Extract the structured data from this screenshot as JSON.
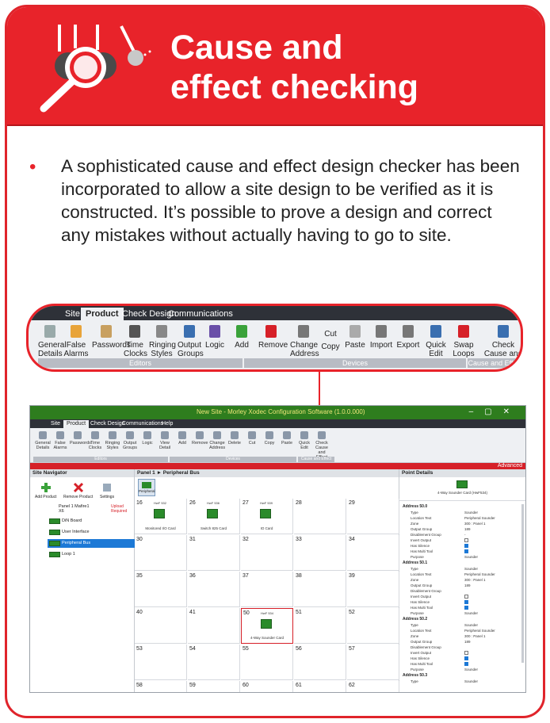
{
  "header": {
    "title_line1": "Cause and",
    "title_line2": "effect checking",
    "icon": "magnifier-icon"
  },
  "bullet": {
    "text": "A sophisticated cause and effect design checker has been incorporated to allow a site design to be verified as it is constructed. It’s possible to prove a design and correct any mistakes without actually having to go to site."
  },
  "ribbon_zoom": {
    "tabs": [
      "Site",
      "Product",
      "Check Design",
      "Communications"
    ],
    "active_tab": "Product",
    "buttons": [
      {
        "label": "General Details",
        "icon": "document-icon"
      },
      {
        "label": "False Alarms",
        "icon": "alarm-icon"
      },
      {
        "label": "Passwords",
        "icon": "key-icon"
      },
      {
        "label": "Time Clocks",
        "icon": "clock-icon"
      },
      {
        "label": "Ringing Styles",
        "icon": "speaker-icon"
      },
      {
        "label": "Output Groups",
        "icon": "arrows-icon"
      },
      {
        "label": "Logic",
        "icon": "logic-icon"
      },
      {
        "label": "Add",
        "icon": "plus-icon"
      },
      {
        "label": "Remove",
        "icon": "x-icon"
      },
      {
        "label": "Change Address",
        "icon": "address-icon"
      },
      {
        "label": "Cut",
        "icon": "scissors-icon"
      },
      {
        "label": "Copy",
        "icon": "copy-icon"
      },
      {
        "label": "Paste",
        "icon": "paste-icon"
      },
      {
        "label": "Import",
        "icon": "import-icon"
      },
      {
        "label": "Export",
        "icon": "export-icon"
      },
      {
        "label": "Quick Edit",
        "icon": "pencil-icon"
      },
      {
        "label": "Swap Loops",
        "icon": "swap-icon"
      },
      {
        "label": "Check Cause and Effect",
        "icon": "check-effect-icon"
      }
    ],
    "groups": [
      "Editors",
      "Devices",
      "Cause and Effect"
    ]
  },
  "app": {
    "title": "New Site - Morley Xodec Configuration Software (1.0.0.000)",
    "tabs": [
      "Site",
      "Product",
      "Check Design",
      "Communications",
      "Help"
    ],
    "active_tab": "Product",
    "ribbon_buttons": [
      "General Details",
      "False Alarms",
      "Passwords",
      "Time Clocks",
      "Ringing Styles",
      "Output Groups",
      "Logic",
      "View Detail",
      "Add",
      "Remove",
      "Change Address",
      "Delete",
      "Cut",
      "Copy",
      "Paste",
      "Quick Edit",
      "Check Cause and Effect"
    ],
    "ribbon_groups": [
      "Editors",
      "Devices",
      "Cause and Effect"
    ],
    "advanced_label": "Advanced",
    "site_navigator": {
      "title": "Site Navigator",
      "buttons": [
        "Add Product",
        "Remove Product",
        "Settings"
      ],
      "panel_label": "Panel 1 Mafire1 X6",
      "upload_label": "Upload Required",
      "items": [
        "DiN Board",
        "User Interface",
        "Peripheral Bus",
        "Loop 1"
      ],
      "selected": "Peripheral Bus"
    },
    "breadcrumb": "Panel 1 ► Peripheral Bus",
    "bus_button": "Peripheral",
    "grid": [
      {
        "num": "16",
        "hw": "HwF 532",
        "caption": "Monitored I/O Card",
        "device": true
      },
      {
        "num": "26",
        "hw": "HwF 536",
        "caption": "Switch 825 Card",
        "device": true
      },
      {
        "num": "27",
        "hw": "HwF 539",
        "caption": "IO Card",
        "device": true
      },
      {
        "num": "28"
      },
      {
        "num": "29"
      },
      {
        "num": "30"
      },
      {
        "num": "31"
      },
      {
        "num": "32"
      },
      {
        "num": "33"
      },
      {
        "num": "34"
      },
      {
        "num": "35"
      },
      {
        "num": "36"
      },
      {
        "num": "37"
      },
      {
        "num": "38"
      },
      {
        "num": "39"
      },
      {
        "num": "40"
      },
      {
        "num": "41"
      },
      {
        "num": "50",
        "hw": "HwF 534",
        "caption": "4-Way Sounder Card",
        "device": true,
        "highlight": true
      },
      {
        "num": "51"
      },
      {
        "num": "52"
      },
      {
        "num": "53"
      },
      {
        "num": "54"
      },
      {
        "num": "55"
      },
      {
        "num": "56"
      },
      {
        "num": "57"
      },
      {
        "num": "58"
      },
      {
        "num": "59"
      },
      {
        "num": "60"
      },
      {
        "num": "61"
      },
      {
        "num": "62"
      }
    ],
    "point_details": {
      "title": "Point Details",
      "device_caption": "4-Way Sounder Card (HwF534)",
      "sections": [
        {
          "name": "Address 50.0",
          "rows": [
            [
              "Type",
              "Sounder"
            ],
            [
              "Location Text",
              "Peripheral Sounder"
            ],
            [
              "Zone",
              "300 : Panel 1"
            ],
            [
              "Output Group",
              "189"
            ],
            [
              "Disablement Group",
              "-"
            ],
            [
              "Invert Output",
              "off"
            ],
            [
              "Has Silence",
              "on"
            ],
            [
              "Has Multi Tool",
              "on"
            ],
            [
              "Purpose",
              "Sounder"
            ]
          ]
        },
        {
          "name": "Address 50.1",
          "rows": [
            [
              "Type",
              "Sounder"
            ],
            [
              "Location Text",
              "Peripheral Sounder"
            ],
            [
              "Zone",
              "300 : Panel 1"
            ],
            [
              "Output Group",
              "189"
            ],
            [
              "Disablement Group",
              ""
            ],
            [
              "Invert Output",
              "off"
            ],
            [
              "Has Silence",
              "on"
            ],
            [
              "Has Multi Tool",
              "on"
            ],
            [
              "Purpose",
              "Sounder"
            ]
          ]
        },
        {
          "name": "Address 50.2",
          "rows": [
            [
              "Type",
              "Sounder"
            ],
            [
              "Location Text",
              "Peripheral Sounder"
            ],
            [
              "Zone",
              "300 : Panel 1"
            ],
            [
              "Output Group",
              "189"
            ],
            [
              "Disablement Group",
              ""
            ],
            [
              "Invert Output",
              "off"
            ],
            [
              "Has Silence",
              "on"
            ],
            [
              "Has Multi Tool",
              "on"
            ],
            [
              "Purpose",
              "Sounder"
            ]
          ]
        },
        {
          "name": "Address 50.3",
          "rows": [
            [
              "Type",
              "Sounder"
            ]
          ]
        }
      ]
    }
  },
  "colors": {
    "brand_red": "#e8232a",
    "green": "#2a8b2a",
    "blue": "#1d79d6"
  }
}
